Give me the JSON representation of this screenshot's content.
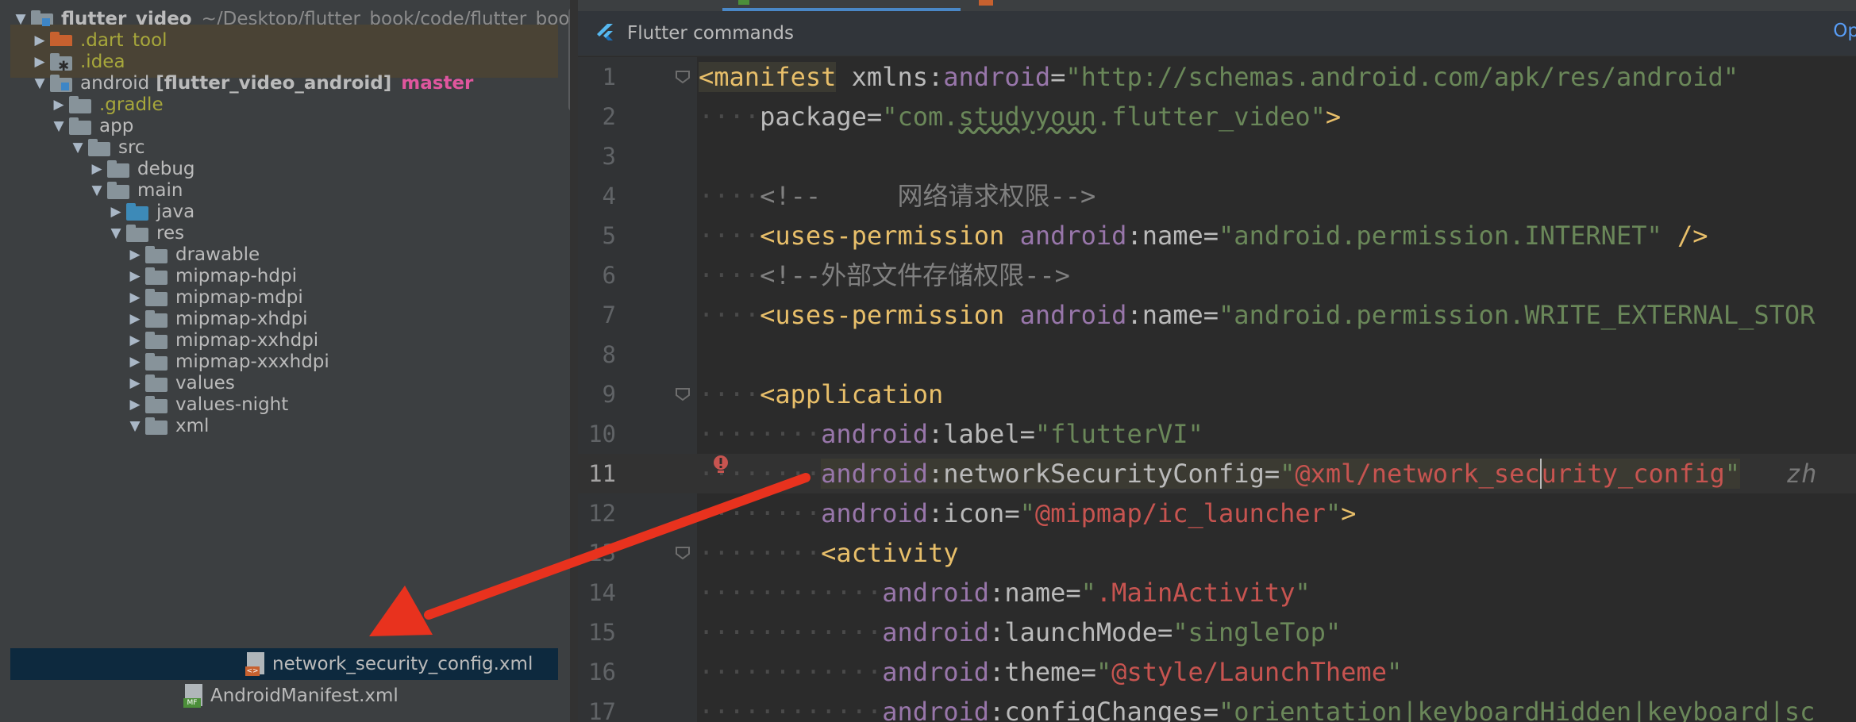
{
  "project_tree": {
    "rows": [
      {
        "label": "flutter_video",
        "extra": "~/Desktop/flutter_book/code/flutter_book_",
        "arrow": "▼"
      },
      {
        "label": ".dart_tool",
        "arrow": "▶"
      },
      {
        "label": ".idea",
        "arrow": "▶"
      },
      {
        "label": "android",
        "module": "[flutter_video_android]",
        "branch": "master",
        "arrow": "▼"
      },
      {
        "label": ".gradle",
        "arrow": "▶"
      },
      {
        "label": "app",
        "arrow": "▼"
      },
      {
        "label": "src",
        "arrow": "▼"
      },
      {
        "label": "debug",
        "arrow": "▶"
      },
      {
        "label": "main",
        "arrow": "▼"
      },
      {
        "label": "java",
        "arrow": "▶"
      },
      {
        "label": "res",
        "arrow": "▼"
      },
      {
        "label": "drawable",
        "arrow": "▶"
      },
      {
        "label": "mipmap-hdpi",
        "arrow": "▶"
      },
      {
        "label": "mipmap-mdpi",
        "arrow": "▶"
      },
      {
        "label": "mipmap-xhdpi",
        "arrow": "▶"
      },
      {
        "label": "mipmap-xxhdpi",
        "arrow": "▶"
      },
      {
        "label": "mipmap-xxxhdpi",
        "arrow": "▶"
      },
      {
        "label": "values",
        "arrow": "▶"
      },
      {
        "label": "values-night",
        "arrow": "▶"
      },
      {
        "label": "xml",
        "arrow": "▼"
      },
      {
        "label": "network_security_config.xml",
        "file_tag": "<>"
      },
      {
        "label": "AndroidManifest.xml",
        "file_tag": "MF"
      }
    ]
  },
  "toolbar": {
    "title": "Flutter commands",
    "link": "Op"
  },
  "editor": {
    "line_numbers": [
      "1",
      "2",
      "3",
      "4",
      "5",
      "6",
      "7",
      "8",
      "9",
      "10",
      "11",
      "12",
      "13",
      "14",
      "15",
      "16",
      "17"
    ],
    "lines": {
      "l1": {
        "tag_open": "<manifest",
        "attr_local": "xmlns:",
        "ns": "android",
        "eq": "=",
        "str": "\"http://schemas.android.com/apk/res/android\""
      },
      "l2": {
        "attr": "package",
        "eq": "=",
        "q1": "\"com.",
        "typo": "studyyoun",
        "q2": ".flutter_video\"",
        "close": ">"
      },
      "l4": {
        "comment": "<!--     网络请求权限-->"
      },
      "l5": {
        "tag": "<uses-permission",
        "ns": "android",
        "colon": ":",
        "attr": "name",
        "eq": "=",
        "str": "\"android.permission.INTERNET\"",
        "close": "/>"
      },
      "l6": {
        "comment": "<!--外部文件存储权限-->"
      },
      "l7": {
        "tag": "<uses-permission",
        "ns": "android",
        "colon": ":",
        "attr": "name",
        "eq": "=",
        "str": "\"android.permission.WRITE_EXTERNAL_STOR"
      },
      "l9": {
        "tag": "<application"
      },
      "l10": {
        "ns": "android",
        "colon": ":",
        "attr": "label",
        "eq": "=",
        "str": "\"flutterVI\""
      },
      "l11": {
        "ns": "android",
        "colon": ":",
        "attr": "networkSecurityConfig",
        "eq": "=",
        "q": "\"",
        "res_a": "@xml/network_sec",
        "res_b": "urity_config",
        "q2": "\"",
        "hint": "zh"
      },
      "l12": {
        "ns": "android",
        "colon": ":",
        "attr": "icon",
        "eq": "=",
        "q": "\"",
        "res": "@mipmap/ic_launcher",
        "q2": "\"",
        "close": ">"
      },
      "l13": {
        "tag": "<activity"
      },
      "l14": {
        "ns": "android",
        "colon": ":",
        "attr": "name",
        "eq": "=",
        "q": "\"",
        "res": ".MainActivity",
        "q2": "\""
      },
      "l15": {
        "ns": "android",
        "colon": ":",
        "attr": "launchMode",
        "eq": "=",
        "str": "\"singleTop\""
      },
      "l16": {
        "ns": "android",
        "colon": ":",
        "attr": "theme",
        "eq": "=",
        "q": "\"",
        "res": "@style/LaunchTheme",
        "q2": "\""
      },
      "l17": {
        "ns": "android",
        "colon": ":",
        "attr": "configChanges",
        "eq": "=",
        "str": "\"orientation|keyboardHidden|keyboard|sc"
      }
    }
  },
  "colors": {
    "arrow": "#e8321e",
    "tag": "#e8bf6a",
    "namespace": "#9876aa",
    "string": "#6a8759",
    "resource": "#c75450"
  }
}
